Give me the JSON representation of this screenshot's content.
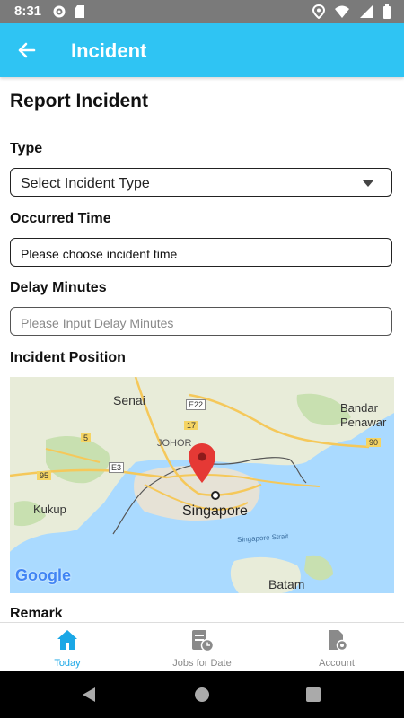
{
  "status_bar": {
    "time": "8:31"
  },
  "app_bar": {
    "title": "Incident"
  },
  "form": {
    "heading": "Report Incident",
    "type_label": "Type",
    "type_value": "Select Incident Type",
    "occurred_label": "Occurred Time",
    "occurred_value": "Please choose incident time",
    "delay_label": "Delay Minutes",
    "delay_placeholder": "Please Input Delay Minutes",
    "position_label": "Incident Position",
    "remark_label": "Remark"
  },
  "map": {
    "places": [
      "Senai",
      "Bandar Penawar",
      "JOHOR",
      "Kukup",
      "Singapore",
      "Singapore Strait",
      "Batam"
    ],
    "road_labels": [
      "E22",
      "17",
      "5",
      "E3",
      "95",
      "90"
    ],
    "logo": "Google"
  },
  "bottom_nav": {
    "items": [
      {
        "label": "Today",
        "icon": "home-icon",
        "active": true
      },
      {
        "label": "Jobs for Date",
        "icon": "calendar-clock-icon",
        "active": false
      },
      {
        "label": "Account",
        "icon": "account-settings-icon",
        "active": false
      }
    ]
  },
  "colors": {
    "app_bar": "#2fc4f3",
    "active_nav": "#1aa7e6",
    "inactive_nav": "#8a8a8a",
    "pin": "#e53935",
    "water": "#aadaff",
    "land": "#e8ecd9"
  }
}
